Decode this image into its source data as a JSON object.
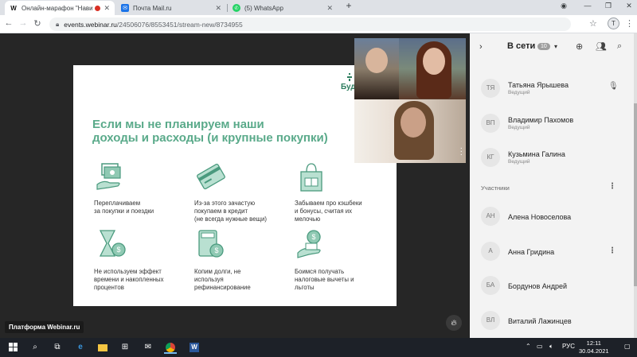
{
  "browser": {
    "tabs": [
      {
        "favicon": "W",
        "title": "Онлайн-марафон \"Навигат",
        "recording": true,
        "active": true
      },
      {
        "favicon": "mail-icon",
        "title": "Почта Mail.ru",
        "active": false
      },
      {
        "favicon": "whatsapp-icon",
        "title": "(5) WhatsApp",
        "active": false
      }
    ],
    "new_tab": "+",
    "url_host": "events.webinar.ru",
    "url_path": "/24506076/8553451/stream-new/8734955",
    "profile_initial": "T"
  },
  "slide": {
    "heading_line1": "Если мы не планируем наши",
    "heading_line2": "доходы и расходы (и крупные покупки)",
    "logo_text": "Буд",
    "items": [
      {
        "icon": "money-hand-icon",
        "line1": "Переплачиваем",
        "line2": "за покупки и поездки",
        "line3": ""
      },
      {
        "icon": "credit-card-icon",
        "line1": "Из-за этого зачастую",
        "line2": "покупаем в кредит",
        "line3": "(не всегда нужные вещи)"
      },
      {
        "icon": "gift-bag-icon",
        "line1": "Забываем про кэшбеки",
        "line2": "и бонусы, считая их",
        "line3": "мелочью"
      },
      {
        "icon": "hourglass-coin-icon",
        "line1": "Не используем эффект",
        "line2": "времени и накопленных",
        "line3": "процентов"
      },
      {
        "icon": "calculator-icon",
        "line1": "Копим долги, не",
        "line2": "используя",
        "line3": "рефинансирование"
      },
      {
        "icon": "coin-hand-icon",
        "line1": "Боимся получать",
        "line2": "налоговые вычеты и",
        "line3": "льготы"
      }
    ]
  },
  "stage": {
    "platform_label": "Платформа Webinar.ru"
  },
  "panel": {
    "title": "В сети",
    "count": "10",
    "hosts": [
      {
        "initials": "ТЯ",
        "name": "Татьяна Ярышева",
        "role": "Ведущий",
        "mic": true
      },
      {
        "initials": "ВП",
        "name": "Владимир Пахомов",
        "role": "Ведущий"
      },
      {
        "initials": "КГ",
        "name": "Кузьмина Галина",
        "role": "Ведущий"
      }
    ],
    "participants_label": "Участники",
    "participants": [
      {
        "initials": "АН",
        "name": "Алена Новоселова"
      },
      {
        "initials": "А",
        "name": "Анна Гридина"
      },
      {
        "initials": "БА",
        "name": "Бордунов Андрей"
      },
      {
        "initials": "ВЛ",
        "name": "Виталий Лажинцев"
      }
    ]
  },
  "taskbar": {
    "lang": "РУС",
    "time": "12:11",
    "date": "30.04.2021"
  }
}
